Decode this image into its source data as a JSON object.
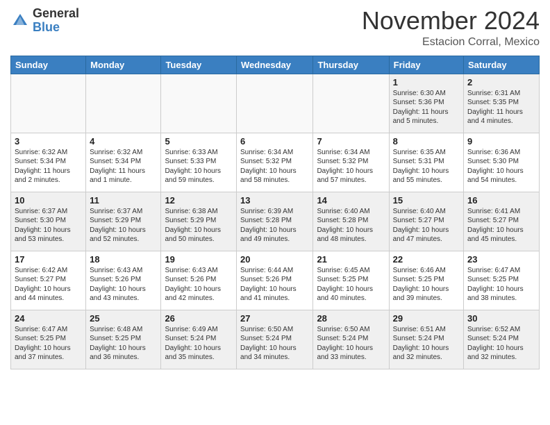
{
  "header": {
    "logo_general": "General",
    "logo_blue": "Blue",
    "month": "November 2024",
    "location": "Estacion Corral, Mexico"
  },
  "weekdays": [
    "Sunday",
    "Monday",
    "Tuesday",
    "Wednesday",
    "Thursday",
    "Friday",
    "Saturday"
  ],
  "weeks": [
    [
      {
        "day": "",
        "info": ""
      },
      {
        "day": "",
        "info": ""
      },
      {
        "day": "",
        "info": ""
      },
      {
        "day": "",
        "info": ""
      },
      {
        "day": "",
        "info": ""
      },
      {
        "day": "1",
        "info": "Sunrise: 6:30 AM\nSunset: 5:36 PM\nDaylight: 11 hours\nand 5 minutes."
      },
      {
        "day": "2",
        "info": "Sunrise: 6:31 AM\nSunset: 5:35 PM\nDaylight: 11 hours\nand 4 minutes."
      }
    ],
    [
      {
        "day": "3",
        "info": "Sunrise: 6:32 AM\nSunset: 5:34 PM\nDaylight: 11 hours\nand 2 minutes."
      },
      {
        "day": "4",
        "info": "Sunrise: 6:32 AM\nSunset: 5:34 PM\nDaylight: 11 hours\nand 1 minute."
      },
      {
        "day": "5",
        "info": "Sunrise: 6:33 AM\nSunset: 5:33 PM\nDaylight: 10 hours\nand 59 minutes."
      },
      {
        "day": "6",
        "info": "Sunrise: 6:34 AM\nSunset: 5:32 PM\nDaylight: 10 hours\nand 58 minutes."
      },
      {
        "day": "7",
        "info": "Sunrise: 6:34 AM\nSunset: 5:32 PM\nDaylight: 10 hours\nand 57 minutes."
      },
      {
        "day": "8",
        "info": "Sunrise: 6:35 AM\nSunset: 5:31 PM\nDaylight: 10 hours\nand 55 minutes."
      },
      {
        "day": "9",
        "info": "Sunrise: 6:36 AM\nSunset: 5:30 PM\nDaylight: 10 hours\nand 54 minutes."
      }
    ],
    [
      {
        "day": "10",
        "info": "Sunrise: 6:37 AM\nSunset: 5:30 PM\nDaylight: 10 hours\nand 53 minutes."
      },
      {
        "day": "11",
        "info": "Sunrise: 6:37 AM\nSunset: 5:29 PM\nDaylight: 10 hours\nand 52 minutes."
      },
      {
        "day": "12",
        "info": "Sunrise: 6:38 AM\nSunset: 5:29 PM\nDaylight: 10 hours\nand 50 minutes."
      },
      {
        "day": "13",
        "info": "Sunrise: 6:39 AM\nSunset: 5:28 PM\nDaylight: 10 hours\nand 49 minutes."
      },
      {
        "day": "14",
        "info": "Sunrise: 6:40 AM\nSunset: 5:28 PM\nDaylight: 10 hours\nand 48 minutes."
      },
      {
        "day": "15",
        "info": "Sunrise: 6:40 AM\nSunset: 5:27 PM\nDaylight: 10 hours\nand 47 minutes."
      },
      {
        "day": "16",
        "info": "Sunrise: 6:41 AM\nSunset: 5:27 PM\nDaylight: 10 hours\nand 45 minutes."
      }
    ],
    [
      {
        "day": "17",
        "info": "Sunrise: 6:42 AM\nSunset: 5:27 PM\nDaylight: 10 hours\nand 44 minutes."
      },
      {
        "day": "18",
        "info": "Sunrise: 6:43 AM\nSunset: 5:26 PM\nDaylight: 10 hours\nand 43 minutes."
      },
      {
        "day": "19",
        "info": "Sunrise: 6:43 AM\nSunset: 5:26 PM\nDaylight: 10 hours\nand 42 minutes."
      },
      {
        "day": "20",
        "info": "Sunrise: 6:44 AM\nSunset: 5:26 PM\nDaylight: 10 hours\nand 41 minutes."
      },
      {
        "day": "21",
        "info": "Sunrise: 6:45 AM\nSunset: 5:25 PM\nDaylight: 10 hours\nand 40 minutes."
      },
      {
        "day": "22",
        "info": "Sunrise: 6:46 AM\nSunset: 5:25 PM\nDaylight: 10 hours\nand 39 minutes."
      },
      {
        "day": "23",
        "info": "Sunrise: 6:47 AM\nSunset: 5:25 PM\nDaylight: 10 hours\nand 38 minutes."
      }
    ],
    [
      {
        "day": "24",
        "info": "Sunrise: 6:47 AM\nSunset: 5:25 PM\nDaylight: 10 hours\nand 37 minutes."
      },
      {
        "day": "25",
        "info": "Sunrise: 6:48 AM\nSunset: 5:25 PM\nDaylight: 10 hours\nand 36 minutes."
      },
      {
        "day": "26",
        "info": "Sunrise: 6:49 AM\nSunset: 5:24 PM\nDaylight: 10 hours\nand 35 minutes."
      },
      {
        "day": "27",
        "info": "Sunrise: 6:50 AM\nSunset: 5:24 PM\nDaylight: 10 hours\nand 34 minutes."
      },
      {
        "day": "28",
        "info": "Sunrise: 6:50 AM\nSunset: 5:24 PM\nDaylight: 10 hours\nand 33 minutes."
      },
      {
        "day": "29",
        "info": "Sunrise: 6:51 AM\nSunset: 5:24 PM\nDaylight: 10 hours\nand 32 minutes."
      },
      {
        "day": "30",
        "info": "Sunrise: 6:52 AM\nSunset: 5:24 PM\nDaylight: 10 hours\nand 32 minutes."
      }
    ]
  ]
}
